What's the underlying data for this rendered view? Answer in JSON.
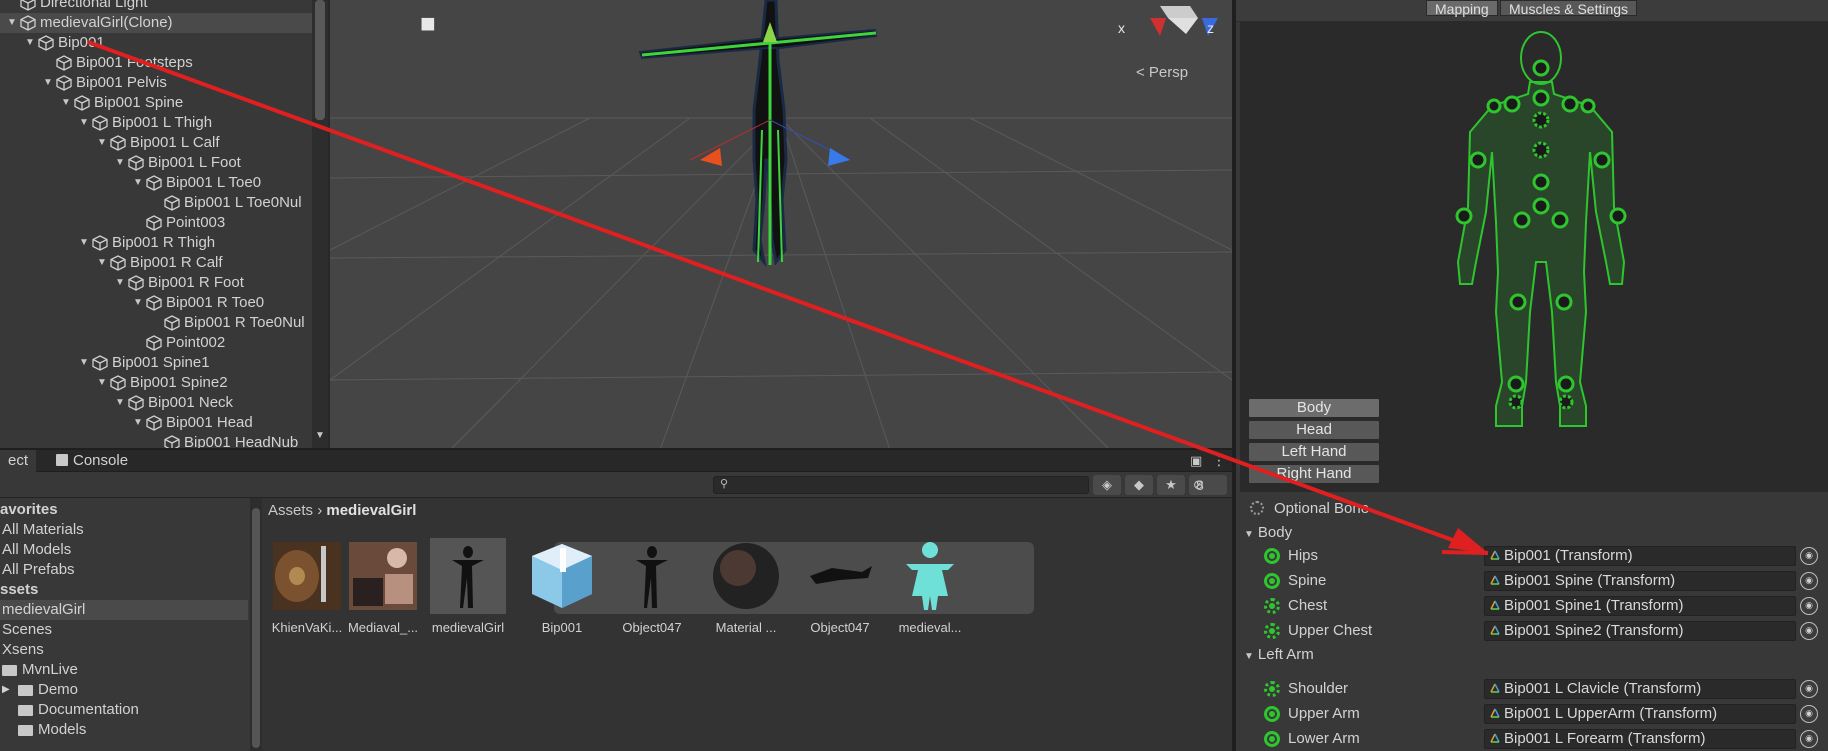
{
  "hierarchy": {
    "items": [
      {
        "label": "Directional Light",
        "depth": 1,
        "arrow": ""
      },
      {
        "label": "medievalGirl(Clone)",
        "depth": 1,
        "arrow": "▼",
        "selected": true
      },
      {
        "label": "Bip001",
        "depth": 2,
        "arrow": "▼"
      },
      {
        "label": "Bip001 Footsteps",
        "depth": 3,
        "arrow": ""
      },
      {
        "label": "Bip001 Pelvis",
        "depth": 3,
        "arrow": "▼"
      },
      {
        "label": "Bip001 Spine",
        "depth": 4,
        "arrow": "▼"
      },
      {
        "label": "Bip001 L Thigh",
        "depth": 5,
        "arrow": "▼"
      },
      {
        "label": "Bip001 L Calf",
        "depth": 6,
        "arrow": "▼"
      },
      {
        "label": "Bip001 L Foot",
        "depth": 7,
        "arrow": "▼"
      },
      {
        "label": "Bip001 L Toe0",
        "depth": 8,
        "arrow": "▼"
      },
      {
        "label": "Bip001 L Toe0Nul",
        "depth": 9,
        "arrow": ""
      },
      {
        "label": "Point003",
        "depth": 8,
        "arrow": ""
      },
      {
        "label": "Bip001 R Thigh",
        "depth": 5,
        "arrow": "▼"
      },
      {
        "label": "Bip001 R Calf",
        "depth": 6,
        "arrow": "▼"
      },
      {
        "label": "Bip001 R Foot",
        "depth": 7,
        "arrow": "▼"
      },
      {
        "label": "Bip001 R Toe0",
        "depth": 8,
        "arrow": "▼"
      },
      {
        "label": "Bip001 R Toe0Nul",
        "depth": 9,
        "arrow": ""
      },
      {
        "label": "Point002",
        "depth": 8,
        "arrow": ""
      },
      {
        "label": "Bip001 Spine1",
        "depth": 5,
        "arrow": "▼"
      },
      {
        "label": "Bip001 Spine2",
        "depth": 6,
        "arrow": "▼"
      },
      {
        "label": "Bip001 Neck",
        "depth": 7,
        "arrow": "▼"
      },
      {
        "label": "Bip001 Head",
        "depth": 8,
        "arrow": "▼"
      },
      {
        "label": "Bip001 HeadNub",
        "depth": 9,
        "arrow": ""
      }
    ]
  },
  "scene": {
    "gizmo_x": "x",
    "gizmo_z": "z",
    "persp_label": "< Persp",
    "camera_icon": "camera-icon"
  },
  "project": {
    "tab_project": "ect",
    "tab_console": "Console",
    "hidden_count": "8",
    "search_placeholder": "",
    "tree": [
      {
        "label": "avorites",
        "indent": 0,
        "bold": true
      },
      {
        "label": "All Materials",
        "indent": 1
      },
      {
        "label": "All Models",
        "indent": 1
      },
      {
        "label": "All Prefabs",
        "indent": 1
      },
      {
        "label": "ssets",
        "indent": 0,
        "bold": true
      },
      {
        "label": "medievalGirl",
        "indent": 1,
        "selected": true
      },
      {
        "label": "Scenes",
        "indent": 1
      },
      {
        "label": "Xsens",
        "indent": 1
      },
      {
        "label": "MvnLive",
        "indent": 1,
        "folder": true
      },
      {
        "label": "Demo",
        "indent": 2,
        "folder": true,
        "arrow": "▶"
      },
      {
        "label": "Documentation",
        "indent": 2,
        "folder": true
      },
      {
        "label": "Models",
        "indent": 2,
        "folder": true
      }
    ],
    "breadcrumb_root": "Assets",
    "breadcrumb_current": "medievalGirl",
    "assets": [
      {
        "label": "KhienVaKi...",
        "kind": "texture-shield"
      },
      {
        "label": "Mediaval_...",
        "kind": "texture-body"
      },
      {
        "label": "medievalGirl",
        "kind": "model"
      },
      {
        "label": "Bip001",
        "kind": "prefab"
      },
      {
        "label": "Object047",
        "kind": "figure"
      },
      {
        "label": "Material ...",
        "kind": "material"
      },
      {
        "label": "Object047",
        "kind": "figure-lying"
      },
      {
        "label": "medieval...",
        "kind": "avatar"
      }
    ]
  },
  "inspector": {
    "btn_mapping": "Mapping",
    "btn_muscles": "Muscles & Settings",
    "body_buttons": [
      "Body",
      "Head",
      "Left Hand",
      "Right Hand"
    ],
    "optional_bone": "Optional Bone",
    "section_body": "Body",
    "section_left_arm": "Left Arm",
    "bones": [
      {
        "name": "Hips",
        "value": "Bip001 (Transform)",
        "dashed": false
      },
      {
        "name": "Spine",
        "value": "Bip001 Spine (Transform)",
        "dashed": false
      },
      {
        "name": "Chest",
        "value": "Bip001 Spine1 (Transform)",
        "dashed": true
      },
      {
        "name": "Upper Chest",
        "value": "Bip001 Spine2 (Transform)",
        "dashed": true
      },
      {
        "name": "Shoulder",
        "value": "Bip001 L Clavicle (Transform)",
        "dashed": true
      },
      {
        "name": "Upper Arm",
        "value": "Bip001 L UpperArm (Transform)",
        "dashed": false
      },
      {
        "name": "Lower Arm",
        "value": "Bip001 L Forearm (Transform)",
        "dashed": false
      }
    ]
  },
  "colors": {
    "accent_green": "#2ec52e",
    "arrow_red": "#e02020",
    "panel": "#383838"
  }
}
